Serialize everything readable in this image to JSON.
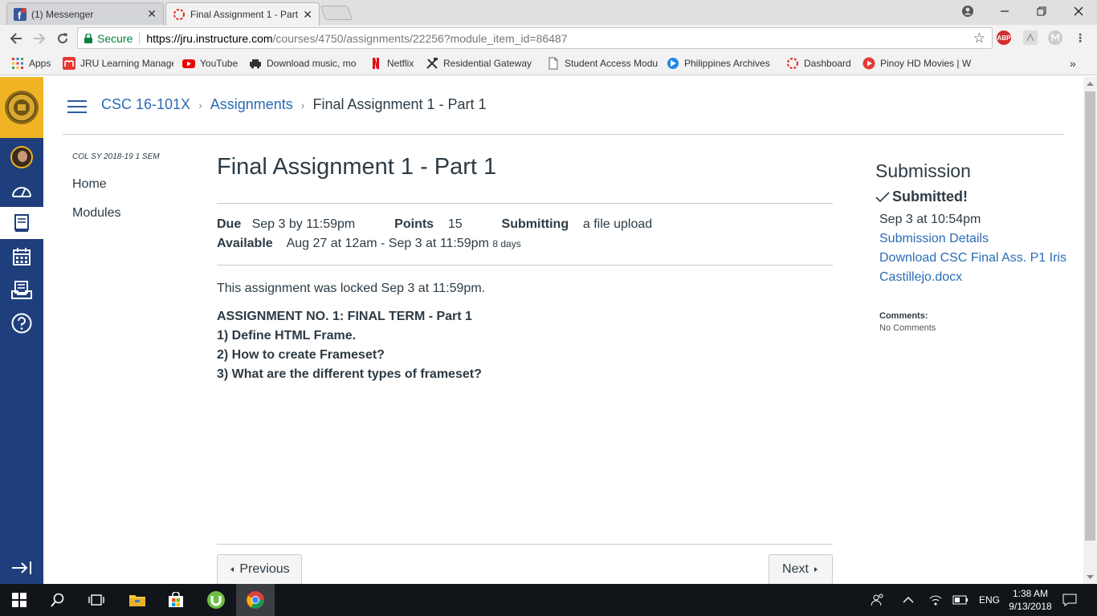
{
  "browser": {
    "tabs": [
      {
        "label": "(1) Messenger",
        "close": "✕"
      },
      {
        "label": "Final Assignment 1 - Part",
        "close": "✕"
      }
    ],
    "secure_label": "Secure",
    "url_host": "https://jru.instructure.com",
    "url_rest": "/courses/4750/assignments/22256?module_item_id=86487",
    "extensions": [
      "ABP"
    ],
    "bookmarks": [
      {
        "label": "Apps"
      },
      {
        "label": "JRU Learning Manage"
      },
      {
        "label": "YouTube"
      },
      {
        "label": "Download music, mo"
      },
      {
        "label": "Netflix"
      },
      {
        "label": "Residential Gateway"
      },
      {
        "label": "Student Access Modu"
      },
      {
        "label": "Philippines Archives"
      },
      {
        "label": "Dashboard"
      },
      {
        "label": "Pinoy HD Movies | W"
      }
    ],
    "bookmarks_overflow": "»"
  },
  "breadcrumb": {
    "course": "CSC 16-101X",
    "section": "Assignments",
    "current": "Final Assignment 1 - Part 1",
    "separator": "›"
  },
  "course_nav": {
    "term": "COL SY 2018-19 1 SEM",
    "items": [
      "Home",
      "Modules"
    ]
  },
  "assignment": {
    "title": "Final Assignment 1 - Part 1",
    "due_label": "Due",
    "due_value": "Sep 3 by 11:59pm",
    "points_label": "Points",
    "points_value": "15",
    "submitting_label": "Submitting",
    "submitting_value": "a file upload",
    "available_label": "Available",
    "available_value": "Aug 27 at 12am - Sep 3 at 11:59pm",
    "available_duration": "8 days",
    "locked_message": "This assignment was locked Sep 3 at 11:59pm.",
    "instructions": [
      "ASSIGNMENT NO. 1: FINAL TERM - Part 1",
      "1) Define HTML Frame.",
      "2) How to create Frameset?",
      "3) What are the different types of frameset?"
    ]
  },
  "pagination": {
    "previous": "Previous",
    "next": "Next"
  },
  "submission": {
    "heading": "Submission",
    "status": "Submitted!",
    "submitted_at": "Sep 3 at 10:54pm",
    "details_link": "Submission Details",
    "download_link_1": "Download CSC Final Ass. P1 Iris",
    "download_link_2": "Castillejo.docx",
    "comments_label": "Comments:",
    "comments_value": "No Comments"
  },
  "taskbar": {
    "language": "ENG",
    "time": "1:38 AM",
    "date": "9/13/2018"
  },
  "colors": {
    "canvas_nav": "#1f3f7c",
    "canvas_logo_bg": "#f0b323",
    "link": "#2b6bb5",
    "text": "#2d3b45",
    "secure_green": "#0b8043"
  }
}
